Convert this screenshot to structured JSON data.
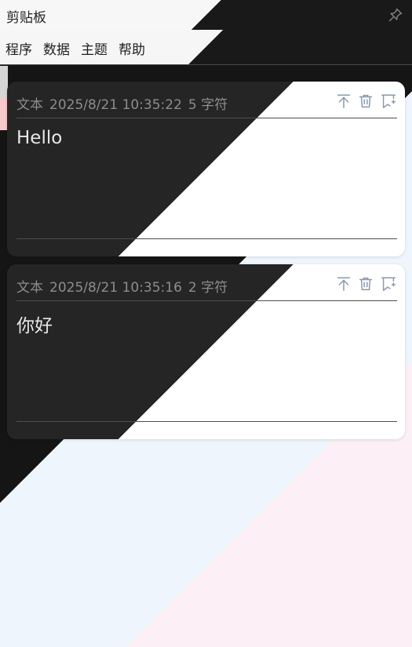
{
  "app": {
    "title": "剪贴板",
    "pin_icon": "pin-icon"
  },
  "menu": {
    "items": [
      {
        "label": "程序"
      },
      {
        "label": "数据"
      },
      {
        "label": "主题"
      },
      {
        "label": "帮助"
      }
    ]
  },
  "clips": [
    {
      "type": "文本",
      "time": "2025/8/21 10:35:22",
      "size": "5 字符",
      "content": "Hello",
      "actions": [
        "arrow-up-to-top-icon",
        "trash-icon",
        "bookmark-add-icon"
      ]
    },
    {
      "type": "文本",
      "time": "2025/8/21 10:35:16",
      "size": "2 字符",
      "content": "你好",
      "actions": [
        "arrow-up-to-top-icon",
        "trash-icon",
        "bookmark-add-icon"
      ]
    }
  ],
  "colors": {
    "dark_bg": "#151515",
    "light_bg": "#eef5fd",
    "accent_pink": "#fcf0f6",
    "icon": "#8a97b0",
    "scroll_thumb": "#f7c9cc"
  }
}
